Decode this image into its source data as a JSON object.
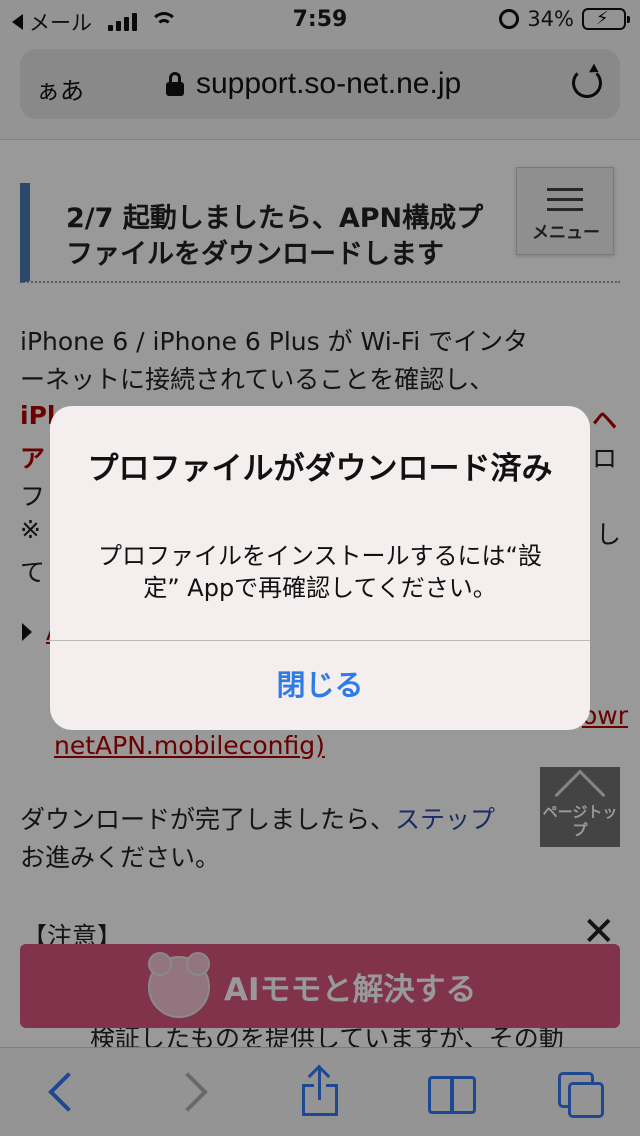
{
  "status_bar": {
    "back_app": "メール",
    "time": "7:59",
    "battery": "34%",
    "battery_level": 0.34
  },
  "url_bar": {
    "text_size_label": "ぁあ",
    "domain": "support.so-net.ne.jp"
  },
  "page": {
    "step_heading_line1": "2/7 起動しましたら、APN構成プ",
    "step_heading_line2": "ファイルをダウンロードします",
    "menu_label": "メニュー",
    "para_line1": "iPhone 6 / iPhone 6 Plus が Wi-Fi でインタ",
    "para_line2": "ーネットに接続されていることを確認し、",
    "frag_red_left": "iPl",
    "frag_red_right": "ヘ",
    "frag_a": "ア",
    "frag_ro": "ロ",
    "frag_fu": "フ",
    "frag_kome": "※",
    "frag_shi": "し",
    "frag_te": "て",
    "frag_link_a": "A",
    "frag_owr": "owr",
    "link_text": "netAPN.mobileconfig)",
    "para2_start": "ダウンロードが完了しましたら、",
    "para2_link": "ステップ",
    "para2_end": "お進みください。",
    "note_heading": "【注意】",
    "close_symbol": "✕",
    "bottom_text": "検証したものを提供していますが、その動",
    "page_top_label": "ページトップ",
    "ai_label": "AIモモと解決する"
  },
  "alert": {
    "title": "プロファイルがダウンロード済み",
    "message": "プロファイルをインストールするには“設定” Appで再確認してください。",
    "button": "閉じる"
  },
  "colors": {
    "link_blue": "#2f7ce6",
    "safari_blue": "#3478f6",
    "heading_bar": "#4a7ab5",
    "red_text": "#b20000",
    "ai_banner": "#d8557e",
    "battery_green": "#34c759"
  },
  "icons": [
    "back-triangle-icon",
    "signal-icon",
    "wifi-icon",
    "alarm-icon",
    "battery-icon",
    "lock-icon",
    "reload-icon",
    "menu-icon",
    "chevron-up-icon",
    "bear-icon",
    "close-icon",
    "back-icon",
    "forward-icon",
    "share-icon",
    "bookmarks-icon",
    "tabs-icon"
  ]
}
